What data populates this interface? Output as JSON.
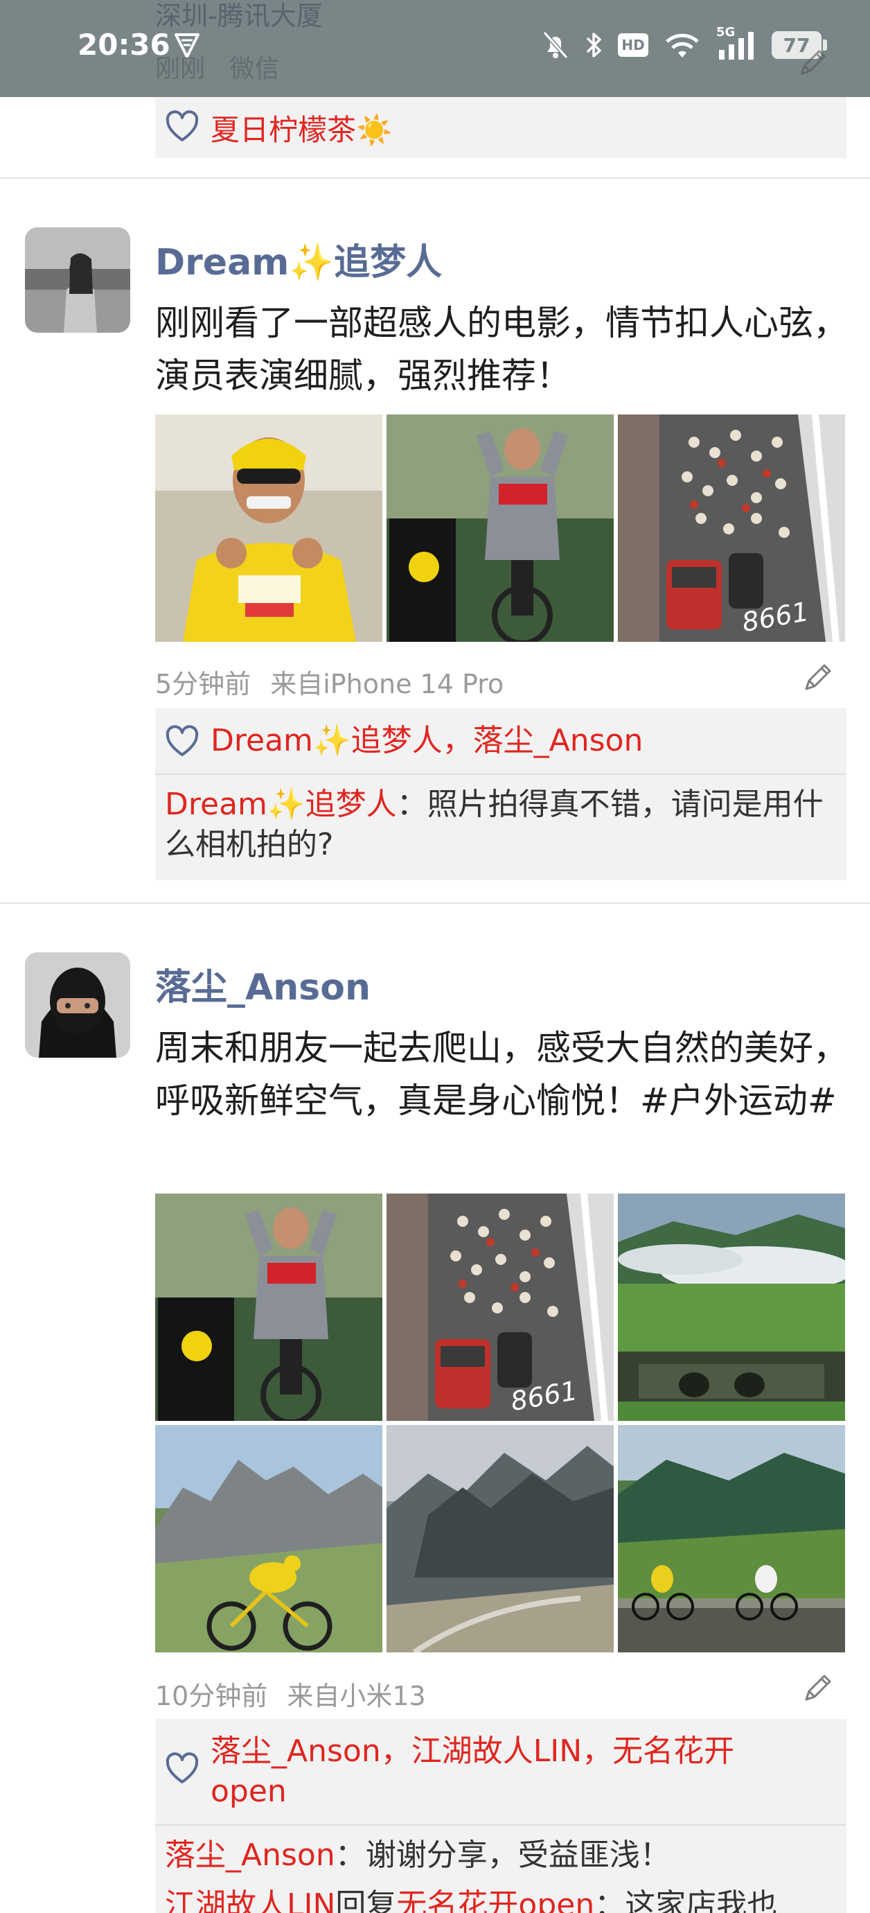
{
  "status_bar": {
    "time": "20:36",
    "icons": [
      "signal-badge-icon",
      "mute-bell-icon",
      "bluetooth-icon",
      "hd-icon",
      "wifi-icon",
      "5g-signal-icon",
      "battery-icon"
    ],
    "hd_label": "HD",
    "network_label": "5G",
    "battery_level": "77"
  },
  "prev_post": {
    "location": "深圳-腾讯大厦",
    "time": "刚刚",
    "source": "微信",
    "likes": [
      "夏日柠檬茶☀️"
    ]
  },
  "posts": [
    {
      "username": "Dream✨追梦人",
      "content": "刚刚看了一部超感人的电影，情节扣人心弦，演员表演细腻，强烈推荐！",
      "images": [
        "cyclist-yellow-jersey-celebrating",
        "cyclist-grey-jersey-podium",
        "peloton-aerial-street"
      ],
      "time": "5分钟前",
      "source": "来自iPhone 14 Pro",
      "likes": [
        "Dream✨追梦人",
        "落尘_Anson"
      ],
      "like_separator": "，",
      "comments": [
        {
          "name": "Dream✨追梦人",
          "text": "：照片拍得真不错，请问是用什么相机拍的?"
        }
      ]
    },
    {
      "username": "落尘_Anson",
      "content": "周末和朋友一起去爬山，感受大自然的美好，呼吸新鲜空气，真是身心愉悦！#户外运动#",
      "images": [
        "cyclist-grey-jersey-podium",
        "peloton-aerial-street",
        "mountain-valley-clouds",
        "mountain-peaks-yellow-cyclist",
        "rocky-mountain-road",
        "mountain-road-cyclists"
      ],
      "time": "10分钟前",
      "source": "来自小米13",
      "likes": [
        "落尘_Anson",
        "江湖故人LIN",
        "无名花开open"
      ],
      "like_separator": "，",
      "comments": [
        {
          "name": "落尘_Anson",
          "text": "：谢谢分享，受益匪浅！"
        },
        {
          "name": "江湖故人LIN",
          "reply_word": "回复",
          "reply_to": "无名花开open",
          "text": "：这家店我也"
        }
      ]
    }
  ],
  "colors": {
    "status_bar_bg": "#7a8588",
    "username": "#586b94",
    "like_name": "#e0251f",
    "interaction_bg": "#f2f2f2",
    "meta": "#9a9a9a"
  }
}
